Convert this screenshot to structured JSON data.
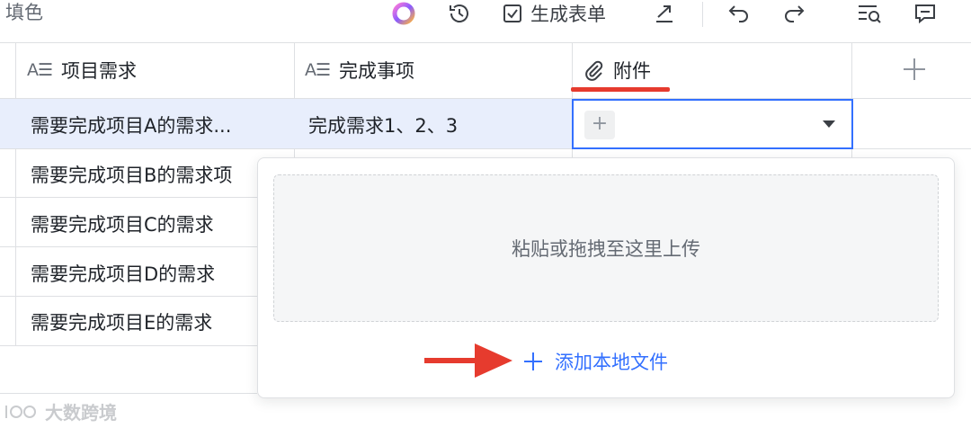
{
  "toolbar": {
    "fill_label": "填色",
    "create_form_label": "生成表单"
  },
  "columns": [
    {
      "label": "项目需求",
      "type_icon": "text-field-icon"
    },
    {
      "label": "完成事项",
      "type_icon": "text-field-icon"
    },
    {
      "label": "附件",
      "type_icon": "paperclip-icon"
    }
  ],
  "rows": [
    {
      "requirement": "需要完成项目A的需求...",
      "done": "完成需求1、2、3"
    },
    {
      "requirement": "需要完成项目B的需求项",
      "done": ""
    },
    {
      "requirement": "需要完成项目C的需求",
      "done": ""
    },
    {
      "requirement": "需要完成项目D的需求",
      "done": ""
    },
    {
      "requirement": "需要完成项目E的需求",
      "done": ""
    }
  ],
  "attachment_cell": {
    "add_symbol": "+"
  },
  "popup": {
    "dropzone_text": "粘贴或拖拽至这里上传",
    "add_local_label": "添加本地文件"
  },
  "watermark": {
    "text": "大数跨境"
  },
  "colors": {
    "accent": "#3370ff",
    "annotation_red": "#e63b2e",
    "selected_row": "#e8eefc",
    "border": "#dee0e3"
  }
}
